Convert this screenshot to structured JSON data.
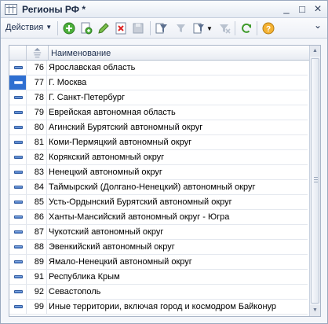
{
  "window": {
    "title": "Регионы РФ *",
    "minimize_glyph": "_",
    "maximize_glyph": "□",
    "close_glyph": "×",
    "pin_glyph": "✕"
  },
  "toolbar": {
    "actions_label": "Действия",
    "actions_caret": "▼",
    "icons": [
      "add-icon",
      "copy-icon",
      "edit-icon",
      "delete-icon",
      "save-icon",
      "filter-icon",
      "filter-by-value-icon",
      "filter-menu-icon",
      "clear-filter-icon",
      "refresh-icon",
      "help-icon"
    ],
    "overflow_glyph": "⌄"
  },
  "grid": {
    "header": {
      "name": "Наименование"
    },
    "rows": [
      {
        "code": "76",
        "name": "Ярославская область"
      },
      {
        "code": "77",
        "name": "Г. Москва",
        "selected": true
      },
      {
        "code": "78",
        "name": "Г. Санкт-Петербург"
      },
      {
        "code": "79",
        "name": "Еврейская автономная область"
      },
      {
        "code": "80",
        "name": "Агинский Бурятский автономный округ"
      },
      {
        "code": "81",
        "name": "Коми-Пермяцкий автономный округ"
      },
      {
        "code": "82",
        "name": "Корякский автономный округ"
      },
      {
        "code": "83",
        "name": "Ненецкий автономный округ"
      },
      {
        "code": "84",
        "name": "Таймырский (Долгано-Ненецкий) автономный округ"
      },
      {
        "code": "85",
        "name": "Усть-Ордынский Бурятский автономный округ"
      },
      {
        "code": "86",
        "name": "Ханты-Мансийский автономный округ - Югра"
      },
      {
        "code": "87",
        "name": "Чукотский автономный округ"
      },
      {
        "code": "88",
        "name": "Эвенкийский автономный округ"
      },
      {
        "code": "89",
        "name": "Ямало-Ненецкий автономный округ"
      },
      {
        "code": "91",
        "name": "Республика Крым"
      },
      {
        "code": "92",
        "name": "Севастополь"
      },
      {
        "code": "99",
        "name": "Иные территории, включая город и космодром Байконур"
      }
    ]
  },
  "colors": {
    "selection": "#2f6fd1",
    "row_marker": "#3f73c4"
  }
}
